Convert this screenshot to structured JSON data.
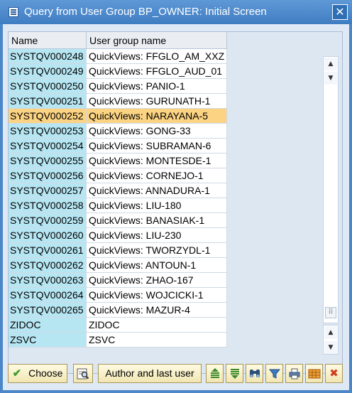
{
  "window": {
    "title": "Query from User Group BP_OWNER: Initial Screen",
    "close_glyph": "✕"
  },
  "table": {
    "columns": [
      "Name",
      "User group name"
    ],
    "rows": [
      {
        "name": "SYSTQV000248",
        "group": "QuickViews: FFGLO_AM_XXZ"
      },
      {
        "name": "SYSTQV000249",
        "group": "QuickViews: FFGLO_AUD_01"
      },
      {
        "name": "SYSTQV000250",
        "group": "QuickViews: PANIO-1"
      },
      {
        "name": "SYSTQV000251",
        "group": "QuickViews: GURUNATH-1"
      },
      {
        "name": "SYSTQV000252",
        "group": "QuickViews: NARAYANA-5",
        "selected": true
      },
      {
        "name": "SYSTQV000253",
        "group": "QuickViews: GONG-33"
      },
      {
        "name": "SYSTQV000254",
        "group": "QuickViews: SUBRAMAN-6"
      },
      {
        "name": "SYSTQV000255",
        "group": "QuickViews: MONTESDE-1"
      },
      {
        "name": "SYSTQV000256",
        "group": "QuickViews: CORNEJO-1"
      },
      {
        "name": "SYSTQV000257",
        "group": "QuickViews: ANNADURA-1"
      },
      {
        "name": "SYSTQV000258",
        "group": "QuickViews: LIU-180"
      },
      {
        "name": "SYSTQV000259",
        "group": "QuickViews: BANASIAK-1"
      },
      {
        "name": "SYSTQV000260",
        "group": "QuickViews: LIU-230"
      },
      {
        "name": "SYSTQV000261",
        "group": "QuickViews: TWORZYDL-1"
      },
      {
        "name": "SYSTQV000262",
        "group": "QuickViews: ANTOUN-1"
      },
      {
        "name": "SYSTQV000263",
        "group": "QuickViews: ZHAO-167"
      },
      {
        "name": "SYSTQV000264",
        "group": "QuickViews: WOJCICKI-1"
      },
      {
        "name": "SYSTQV000265",
        "group": "QuickViews: MAZUR-4"
      },
      {
        "name": "ZIDOC",
        "group": "ZIDOC"
      },
      {
        "name": "ZSVC",
        "group": "ZSVC"
      }
    ]
  },
  "scrollbar": {
    "up_glyph": "▲",
    "down_glyph": "▼",
    "grip_glyph": "⠿"
  },
  "toolbar": {
    "choose_label": "Choose",
    "check_glyph": "✔",
    "author_label": "Author and last user",
    "icons": [
      "find-in-list-icon",
      "sort-ascending-icon",
      "sort-descending-icon",
      "binoculars-icon",
      "filter-icon",
      "print-icon",
      "table-layout-icon",
      "cancel-icon"
    ],
    "cancel_glyph": "✖"
  },
  "colors": {
    "title_bar": "#4a86c8",
    "key_column": "#b7e6f3",
    "selected_row": "#fbd382",
    "button_face": "#f7efc6"
  }
}
